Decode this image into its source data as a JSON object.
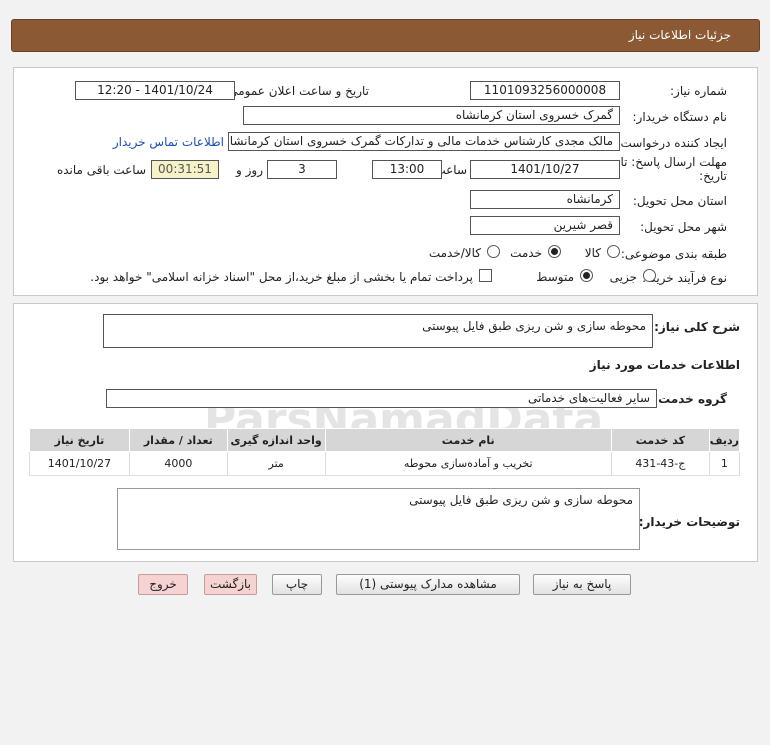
{
  "header": {
    "title": "جزئیات اطلاعات نیاز"
  },
  "form": {
    "need_number_label": "شماره نیاز:",
    "need_number": "1101093256000008",
    "announce_label": "تاریخ و ساعت اعلان عمومی:",
    "announce_value": "1401/10/24 - 12:20",
    "buyer_org_label": "نام دستگاه خریدار:",
    "buyer_org": "گمرک خسروی استان کرمانشاه",
    "creator_label": "ایجاد کننده درخواست:",
    "creator": "مالک مجدی کارشناس خدمات مالی و تدارکات گمرک خسروی استان کرمانشاه",
    "buyer_contact_link": "اطلاعات تماس خریدار",
    "deadline_label_1": "مهلت ارسال پاسخ: تا",
    "deadline_label_2": "تاریخ:",
    "deadline_date": "1401/10/27",
    "time_label": "ساعت",
    "deadline_time": "13:00",
    "days_value": "3",
    "days_label": "روز و",
    "remaining_time": "00:31:51",
    "remaining_label": "ساعت باقی مانده",
    "province_label": "استان محل تحویل:",
    "province": "کرمانشاه",
    "city_label": "شهر محل تحویل:",
    "city": "قصر شیرین",
    "category_label": "طبقه بندی موضوعی:",
    "category_options": [
      "کالا",
      "خدمت",
      "کالا/خدمت"
    ],
    "category_selected": "خدمت",
    "process_label": "نوع فرآیند خرید :",
    "process_options": [
      "جزیی",
      "متوسط"
    ],
    "process_selected": "متوسط",
    "payment_note": "پرداخت تمام یا بخشی از مبلغ خرید،از محل \"اسناد خزانه اسلامی\" خواهد بود."
  },
  "details": {
    "general_desc_label": "شرح کلی نیاز:",
    "general_desc": "محوطه سازی و شن ریزی طبق فایل پیوستی",
    "services_title": "اطلاعات خدمات مورد نیاز",
    "service_group_label": "گروه خدمت:",
    "service_group": "سایر فعالیت‌های خدماتی",
    "table": {
      "headers": [
        "ردیف",
        "کد خدمت",
        "نام خدمت",
        "واحد اندازه گیری",
        "تعداد / مقدار",
        "تاریخ نیاز"
      ],
      "rows": [
        [
          "1",
          "ج-43-431",
          "تخریب و آماده‌سازی محوطه",
          "متر",
          "4000",
          "1401/10/27"
        ]
      ]
    },
    "buyer_notes_label": "توضیحات خریدار:",
    "buyer_notes": "محوطه سازی و شن ریزی طبق فایل پیوستی"
  },
  "buttons": {
    "reply": "پاسخ به نیاز",
    "view_docs": "مشاهده مدارک پیوستی (1)",
    "print": "چاپ",
    "back": "بازگشت",
    "exit": "خروج"
  },
  "colors": {
    "header_bg": "#8b5a35",
    "link": "#1a4fb5",
    "timer_bg": "#f5f2c8"
  }
}
